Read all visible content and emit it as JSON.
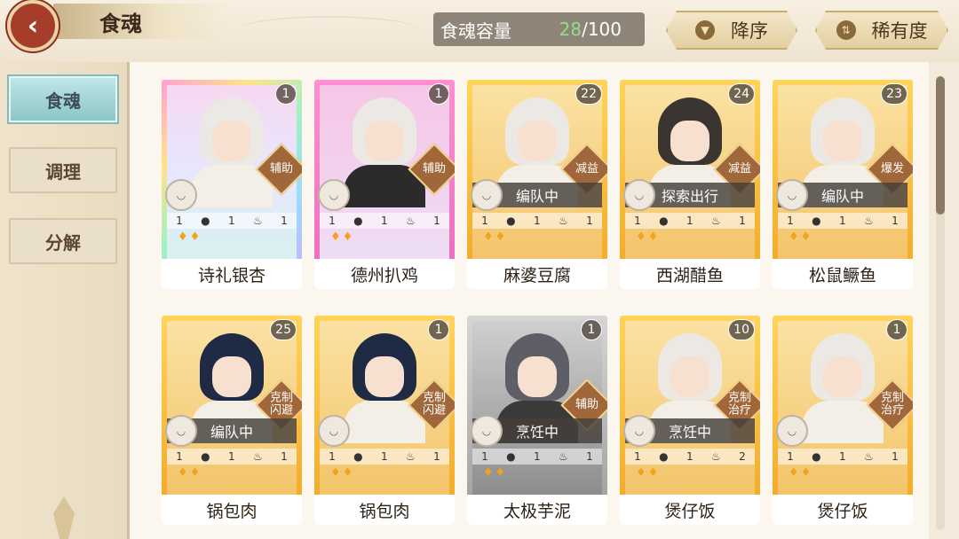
{
  "header": {
    "title": "食魂",
    "capacity_label": "食魂容量",
    "capacity_current": "28",
    "capacity_max": "/100",
    "sort_order_label": "降序",
    "sort_rarity_label": "稀有度"
  },
  "sidebar": {
    "items": [
      {
        "label": "食魂",
        "active": true
      },
      {
        "label": "调理",
        "active": false
      },
      {
        "label": "分解",
        "active": false
      }
    ]
  },
  "cards": [
    {
      "name": "诗礼银杏",
      "level": "1",
      "role": "辅助",
      "status": "",
      "stats": [
        "1",
        "1",
        "1"
      ],
      "rarity": "rainbow"
    },
    {
      "name": "德州扒鸡",
      "level": "1",
      "role": "辅助",
      "status": "",
      "stats": [
        "1",
        "1",
        "1"
      ],
      "rarity": "pink"
    },
    {
      "name": "麻婆豆腐",
      "level": "22",
      "role": "减益",
      "status": "编队中",
      "stats": [
        "1",
        "1",
        "1"
      ],
      "rarity": "gold"
    },
    {
      "name": "西湖醋鱼",
      "level": "24",
      "role": "减益",
      "status": "探索出行",
      "stats": [
        "1",
        "1",
        "1"
      ],
      "rarity": "gold"
    },
    {
      "name": "松鼠鳜鱼",
      "level": "23",
      "role": "爆发",
      "status": "编队中",
      "stats": [
        "1",
        "1",
        "1"
      ],
      "rarity": "gold"
    },
    {
      "name": "锅包肉",
      "level": "25",
      "role": "克制\n闪避",
      "status": "编队中",
      "stats": [
        "1",
        "1",
        "1"
      ],
      "rarity": "gold"
    },
    {
      "name": "锅包肉",
      "level": "1",
      "role": "克制\n闪避",
      "status": "",
      "stats": [
        "1",
        "1",
        "1"
      ],
      "rarity": "gold"
    },
    {
      "name": "太极芋泥",
      "level": "1",
      "role": "辅助",
      "status": "烹饪中",
      "stats": [
        "1",
        "1",
        "1"
      ],
      "rarity": "silver"
    },
    {
      "name": "煲仔饭",
      "level": "10",
      "role": "克制\n治疗",
      "status": "烹饪中",
      "stats": [
        "1",
        "1",
        "2"
      ],
      "rarity": "gold"
    },
    {
      "name": "煲仔饭",
      "level": "1",
      "role": "克制\n治疗",
      "status": "",
      "stats": [
        "1",
        "1",
        "1"
      ],
      "rarity": "gold"
    }
  ],
  "colors": {
    "accent": "#a63d2a",
    "capacity_current": "#8fe08a"
  }
}
